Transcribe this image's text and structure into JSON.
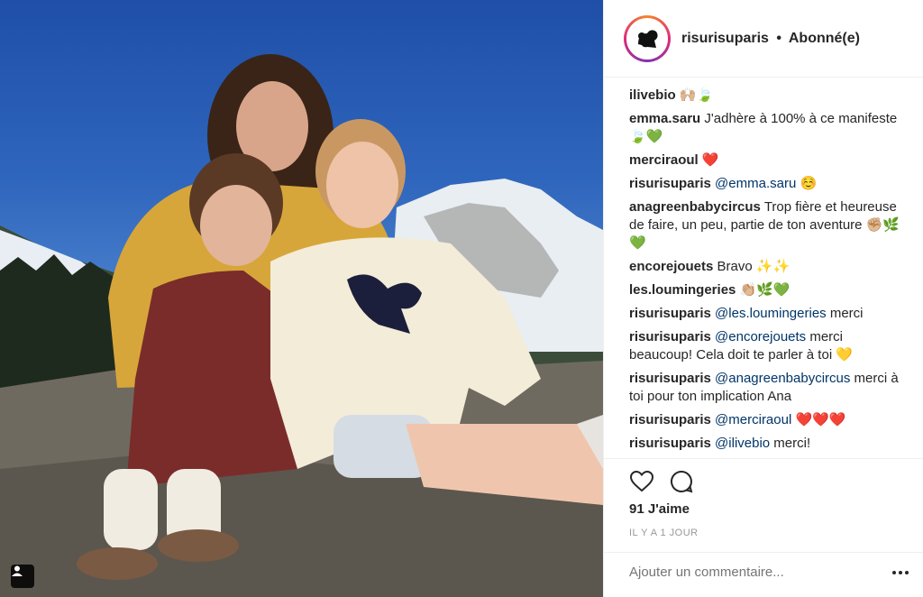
{
  "post": {
    "username": "risurisuparis",
    "separator": "•",
    "follow_status": "Abonné(e)"
  },
  "comments": [
    {
      "user": "ilivebio",
      "parts": [
        "🙌🏼🍃"
      ]
    },
    {
      "user": "emma.saru",
      "parts": [
        "J'adhère à 100% à ce manifeste 🍃💚"
      ]
    },
    {
      "user": "merciraoul",
      "parts": [
        "❤️"
      ]
    },
    {
      "user": "risurisuparis",
      "mention": "@emma.saru",
      "parts": [
        " ☺️"
      ]
    },
    {
      "user": "anagreenbabycircus",
      "parts": [
        "Trop fière et heureuse de faire, un peu, partie de ton aventure ✊🏼🌿💚"
      ]
    },
    {
      "user": "encorejouets",
      "parts": [
        "Bravo ✨✨"
      ]
    },
    {
      "user": "les.loumingeries",
      "parts": [
        "👏🏼🌿💚"
      ]
    },
    {
      "user": "risurisuparis",
      "mention": "@les.loumingeries",
      "parts": [
        " merci"
      ]
    },
    {
      "user": "risurisuparis",
      "mention": "@encorejouets",
      "parts": [
        " merci beaucoup! Cela doit te parler à toi 💛"
      ]
    },
    {
      "user": "risurisuparis",
      "mention": "@anagreenbabycircus",
      "parts": [
        " merci à toi pour ton implication Ana"
      ]
    },
    {
      "user": "risurisuparis",
      "mention": "@merciraoul",
      "parts": [
        " ❤️❤️❤️"
      ]
    },
    {
      "user": "risurisuparis",
      "mention": "@ilivebio",
      "parts": [
        " merci!"
      ]
    }
  ],
  "stats": {
    "likes": "91 J'aime",
    "time": "IL Y A 1 JOUR"
  },
  "add_comment": {
    "placeholder": "Ajouter un commentaire..."
  },
  "icons": {
    "like": "heart-icon",
    "comment": "comment-bubble-icon",
    "more": "more-dots-icon",
    "tag": "user-tag-icon"
  },
  "colors": {
    "mention": "#003569",
    "text": "#262626",
    "muted": "#999999",
    "ring_gradient": [
      "#f58529",
      "#dd2a7b",
      "#8134af"
    ]
  }
}
